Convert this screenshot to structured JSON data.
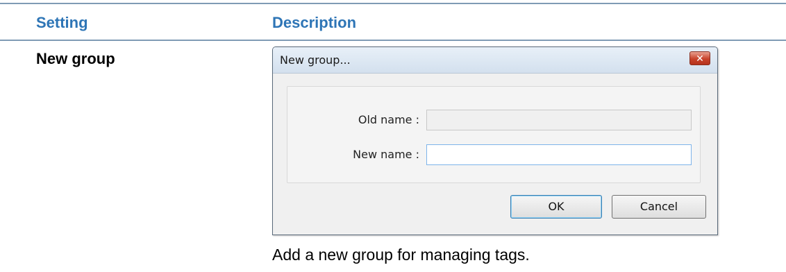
{
  "table": {
    "header_setting": "Setting",
    "header_description": "Description",
    "row": {
      "setting": "New group",
      "description": "Add a new group for managing tags."
    }
  },
  "dialog": {
    "title": "New group...",
    "close_glyph": "✕",
    "old_name_label": "Old name :",
    "old_name_value": "",
    "new_name_label": "New name :",
    "new_name_value": "",
    "ok_label": "OK",
    "cancel_label": "Cancel"
  },
  "colors": {
    "header_text": "#2e75b6",
    "rule": "#7f9bb5",
    "close_button": "#c8432b"
  }
}
